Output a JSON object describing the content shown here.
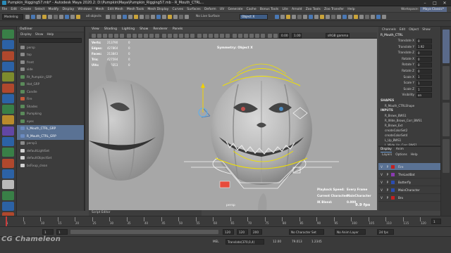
{
  "title": "Pumpkin_Rigging57.mb* - Autodesk Maya 2020.2: D:\\Pumpkin\\Maya\\Pumpkin_Rigging57.mb - R_Mouth_CTRL...",
  "menubar": [
    "File",
    "Edit",
    "Create",
    "Select",
    "Modify",
    "Display",
    "Windows",
    "Mesh",
    "Edit Mesh",
    "Mesh Tools",
    "Mesh Display",
    "Curves",
    "Surfaces",
    "Deform",
    "UV",
    "Generate",
    "Cache",
    "Bonus Tools",
    "Lite",
    "Arnold",
    "Zoo Tools",
    "Zoo Transfer",
    "Help"
  ],
  "workspace": {
    "label": "Workspace:",
    "value": "Maya Classic*"
  },
  "statusline": {
    "mode": "Modeling",
    "objects_label": "all objects",
    "live_surface": "No Live Surface",
    "symmetry": "Object X"
  },
  "outliner": {
    "title": "Outliner",
    "menu": [
      "Display",
      "Show",
      "Help"
    ],
    "items": [
      {
        "label": "persp",
        "selected": false
      },
      {
        "label": "top",
        "selected": false
      },
      {
        "label": "front",
        "selected": false
      },
      {
        "label": "side",
        "selected": false
      },
      {
        "label": "Rt_Pumpkin_GRP",
        "selected": false
      },
      {
        "label": "Hat_GRP",
        "selected": false
      },
      {
        "label": "Candle",
        "selected": false
      },
      {
        "label": "Fire",
        "selected": false
      },
      {
        "label": "Shades",
        "selected": false
      },
      {
        "label": "Pumpking",
        "selected": false
      },
      {
        "label": "eyes",
        "selected": false
      },
      {
        "label": "L_Mouth_CTRL_GRP",
        "selected": true
      },
      {
        "label": "R_Mouth_CTRL_GRP",
        "selected": true
      },
      {
        "label": "persp1",
        "selected": false
      },
      {
        "label": "defaultLightSet",
        "selected": false
      },
      {
        "label": "defaultObjectSet",
        "selected": false
      },
      {
        "label": "bsFixup_clean",
        "selected": false
      }
    ]
  },
  "viewport": {
    "menu": [
      "View",
      "Shading",
      "Lighting",
      "Show",
      "Renderer",
      "Panels"
    ],
    "hud_rows": [
      {
        "k": "Verts:",
        "v": "213790",
        "c": "0"
      },
      {
        "k": "Edges:",
        "v": "427864",
        "c": "0"
      },
      {
        "k": "Faces:",
        "v": "213843",
        "c": "0"
      },
      {
        "k": "Tris:",
        "v": "427594",
        "c": "0"
      },
      {
        "k": "UVs:",
        "v": "249353",
        "c": "0"
      }
    ],
    "symmetry_label": "Symmetry: Object X",
    "camera": "persp",
    "fps": "9.9 fps",
    "play_labels": [
      "Playback Speed:",
      "Current Character:",
      "IK Blend:"
    ],
    "play_values": [
      "Every Frame",
      "MainCharacter",
      "0.000"
    ],
    "color_space": "sRGB gamma",
    "gamma_a": "0.00",
    "gamma_b": "1.00"
  },
  "channelbox": {
    "menu": [
      "Channels",
      "Edit",
      "Object",
      "Show"
    ],
    "object": "R_Mouth_CTRL",
    "channels": [
      {
        "label": "Translate X",
        "value": "0"
      },
      {
        "label": "Translate Y",
        "value": "1.92"
      },
      {
        "label": "Translate Z",
        "value": "0"
      },
      {
        "label": "Rotate X",
        "value": "0"
      },
      {
        "label": "Rotate Y",
        "value": "0"
      },
      {
        "label": "Rotate Z",
        "value": "0"
      },
      {
        "label": "Scale X",
        "value": "1"
      },
      {
        "label": "Scale Y",
        "value": "1"
      },
      {
        "label": "Scale Z",
        "value": "1"
      },
      {
        "label": "Visibility",
        "value": "on"
      }
    ],
    "shapes_label": "SHAPES",
    "shape_name": "R_Mouth_CTRLShape",
    "inputs_label": "INPUTS",
    "inputs": [
      "R_Brows_BWS1",
      "R_Wide_Brows_Corr_BWS1",
      "R_Brows_Ext",
      "createColorSet2",
      "createColorSet4",
      "L_Up_BWS1",
      "L_Wide_Up_Corr_BWS1",
      "R_Up_BWS1"
    ]
  },
  "layers": {
    "tabs": [
      "Display",
      "Anim"
    ],
    "menu": [
      "Layers",
      "Options",
      "Help"
    ],
    "items": [
      {
        "label": "Fire",
        "color": "#c42020",
        "selected": true
      },
      {
        "label": "TheLastBat",
        "color": "#8a3ab0",
        "selected": false
      },
      {
        "label": "Butterfly",
        "color": "#2a4cb0",
        "selected": false
      },
      {
        "label": "MainCharacter",
        "color": "#2a4cb0",
        "selected": false
      },
      {
        "label": "Bro",
        "color": "#c42020",
        "selected": false
      }
    ]
  },
  "script_editor": "Script Editor",
  "timeslider": {
    "ticks": [
      "1",
      "5",
      "10",
      "15",
      "20",
      "25",
      "30",
      "35",
      "40",
      "45",
      "50",
      "55",
      "60",
      "65",
      "70",
      "75",
      "80",
      "85",
      "90",
      "95",
      "100",
      "105",
      "110",
      "115",
      "120"
    ],
    "current_frame": "1"
  },
  "range": {
    "start": "1",
    "end_a": "120",
    "end_b": "120",
    "end_c": "200",
    "no_character": "No Character Set",
    "no_anim_layer": "No Anim Layer",
    "fps": "24 fps"
  },
  "cmdline": {
    "lang": "MEL",
    "result": "Translate(370,0,4)",
    "a": "12.00",
    "b": "79.013",
    "c": "1.2345"
  },
  "watermark": "CG Chameleon",
  "tool_colors": [
    "#3a8c4a",
    "#2a6ab8",
    "#c44b2b",
    "#2a6ab8",
    "#8a9a2c",
    "#c44b2b",
    "#2a6ab8",
    "#3a8c4a",
    "#d09a2a",
    "#6a4ab8",
    "#2a6ab8",
    "#3a8c4a",
    "#c44b2b",
    "#2a6ab8",
    "#d0d0d0",
    "#3a8c4a",
    "#2a6ab8",
    "#c44b2b"
  ]
}
